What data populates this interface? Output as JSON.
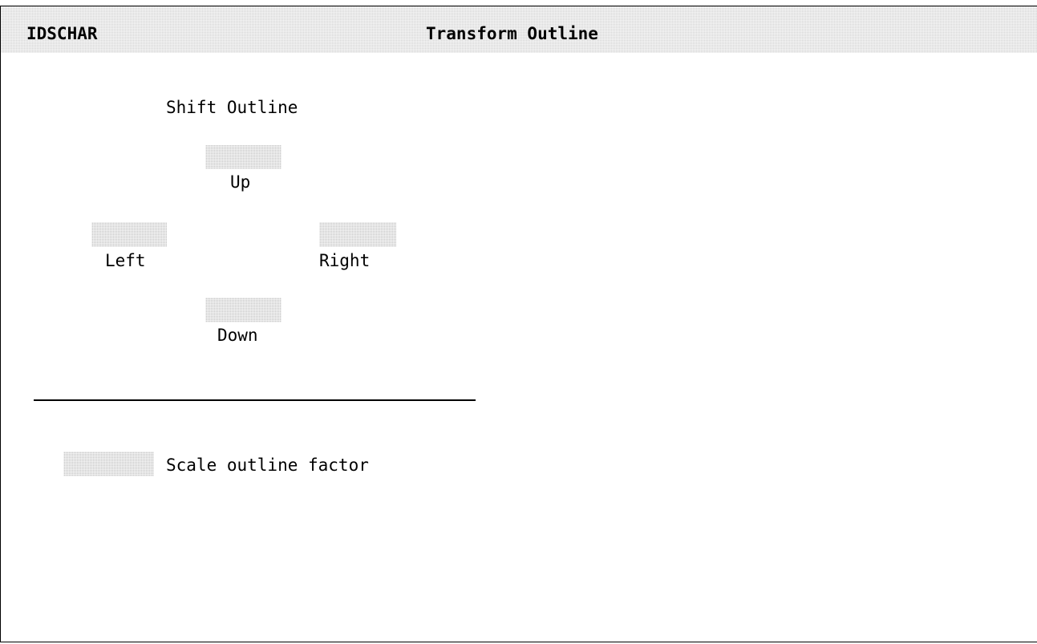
{
  "window": {
    "app_name": "IDSCHAR",
    "title": "Transform Outline"
  },
  "shift": {
    "heading": "Shift Outline",
    "up_label": "Up",
    "left_label": "Left",
    "right_label": "Right",
    "down_label": "Down",
    "up_value": "",
    "left_value": "",
    "right_value": "",
    "down_value": ""
  },
  "scale": {
    "label": "Scale outline factor",
    "value": ""
  },
  "colors": {
    "field_fill": "#c9c9c9",
    "title_bar": "#d6d6d6",
    "text": "#000000"
  }
}
